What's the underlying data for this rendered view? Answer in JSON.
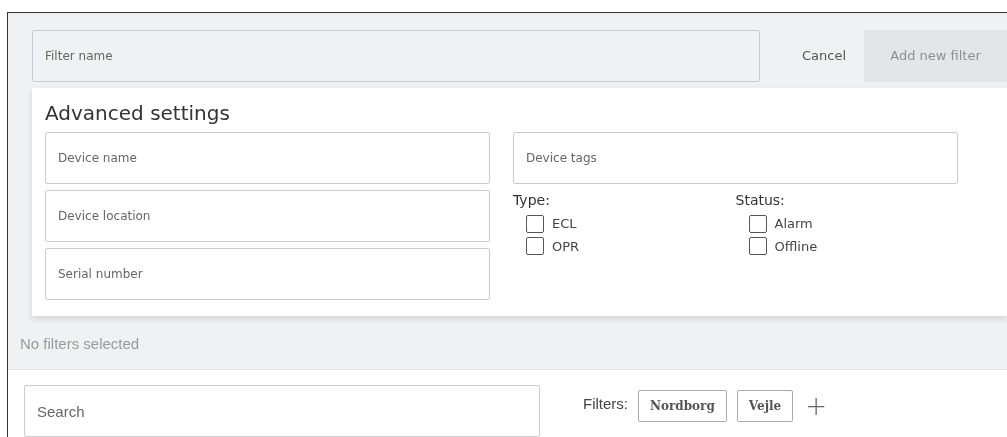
{
  "filter_name": {
    "placeholder": "Filter name"
  },
  "cancel_button": "Cancel",
  "add_button": {
    "label": "Add new filter",
    "disabled": true
  },
  "advanced": {
    "title": "Advanced settings",
    "fields_left": [
      {
        "placeholder": "Device name"
      },
      {
        "placeholder": "Device location"
      },
      {
        "placeholder": "Serial number"
      }
    ],
    "tags_field": {
      "placeholder": "Device tags"
    },
    "groups": [
      {
        "label": "Type:",
        "options": [
          {
            "label": "ECL",
            "checked": false
          },
          {
            "label": "OPR",
            "checked": false
          }
        ]
      },
      {
        "label": "Status:",
        "options": [
          {
            "label": "Alarm",
            "checked": false
          },
          {
            "label": "Offline",
            "checked": false
          }
        ]
      }
    ]
  },
  "empty_message": "No filters selected",
  "search": {
    "placeholder": "Search"
  },
  "filters_label": "Filters:",
  "filter_chips": [
    "Nordborg",
    "Vejle"
  ],
  "add_chip": "+"
}
